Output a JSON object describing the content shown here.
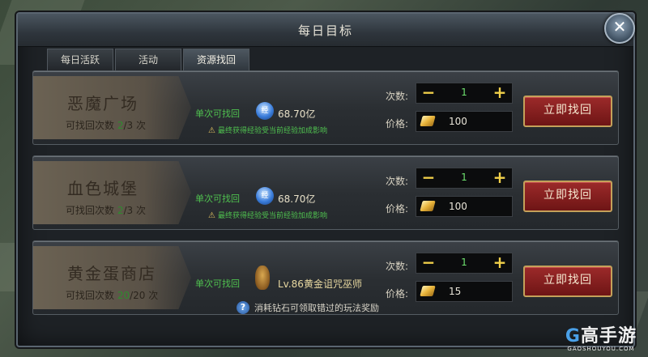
{
  "window": {
    "title": "每日目标"
  },
  "tabs": [
    {
      "label": "每日活跃"
    },
    {
      "label": "活动"
    },
    {
      "label": "资源找回"
    }
  ],
  "labels": {
    "single": "单次可找回",
    "qty": "次数:",
    "price": "价格:",
    "recover_button": "立即找回",
    "remaining_prefix": "可找回次数"
  },
  "rows": [
    {
      "name": "恶魔广场",
      "remaining": "2",
      "total": "/3 次",
      "reward_icon": "exp-icon",
      "reward_icon_text": "经",
      "reward_value": "68.70亿",
      "warning": "最终获得经验受当前经验加成影响",
      "quantity": "1",
      "price": "100"
    },
    {
      "name": "血色城堡",
      "remaining": "2",
      "total": "/3 次",
      "reward_icon": "exp-icon",
      "reward_icon_text": "经",
      "reward_value": "68.70亿",
      "warning": "最终获得经验受当前经验加成影响",
      "quantity": "1",
      "price": "100"
    },
    {
      "name": "黄金蛋商店",
      "remaining": "20",
      "total": "/20 次",
      "reward_icon": "golden-egg-icon",
      "reward_value": "Lv.86黄金诅咒巫师",
      "quantity": "1",
      "price": "15"
    }
  ],
  "footer": {
    "text": "消耗钻石可领取错过的玩法奖励"
  },
  "watermark": {
    "brand": "高手游",
    "url": "GAOSHOUYOU.COM"
  },
  "colors": {
    "accent_green": "#4fc04f",
    "button_red": "#8a2020",
    "gold": "#f2d14a"
  }
}
